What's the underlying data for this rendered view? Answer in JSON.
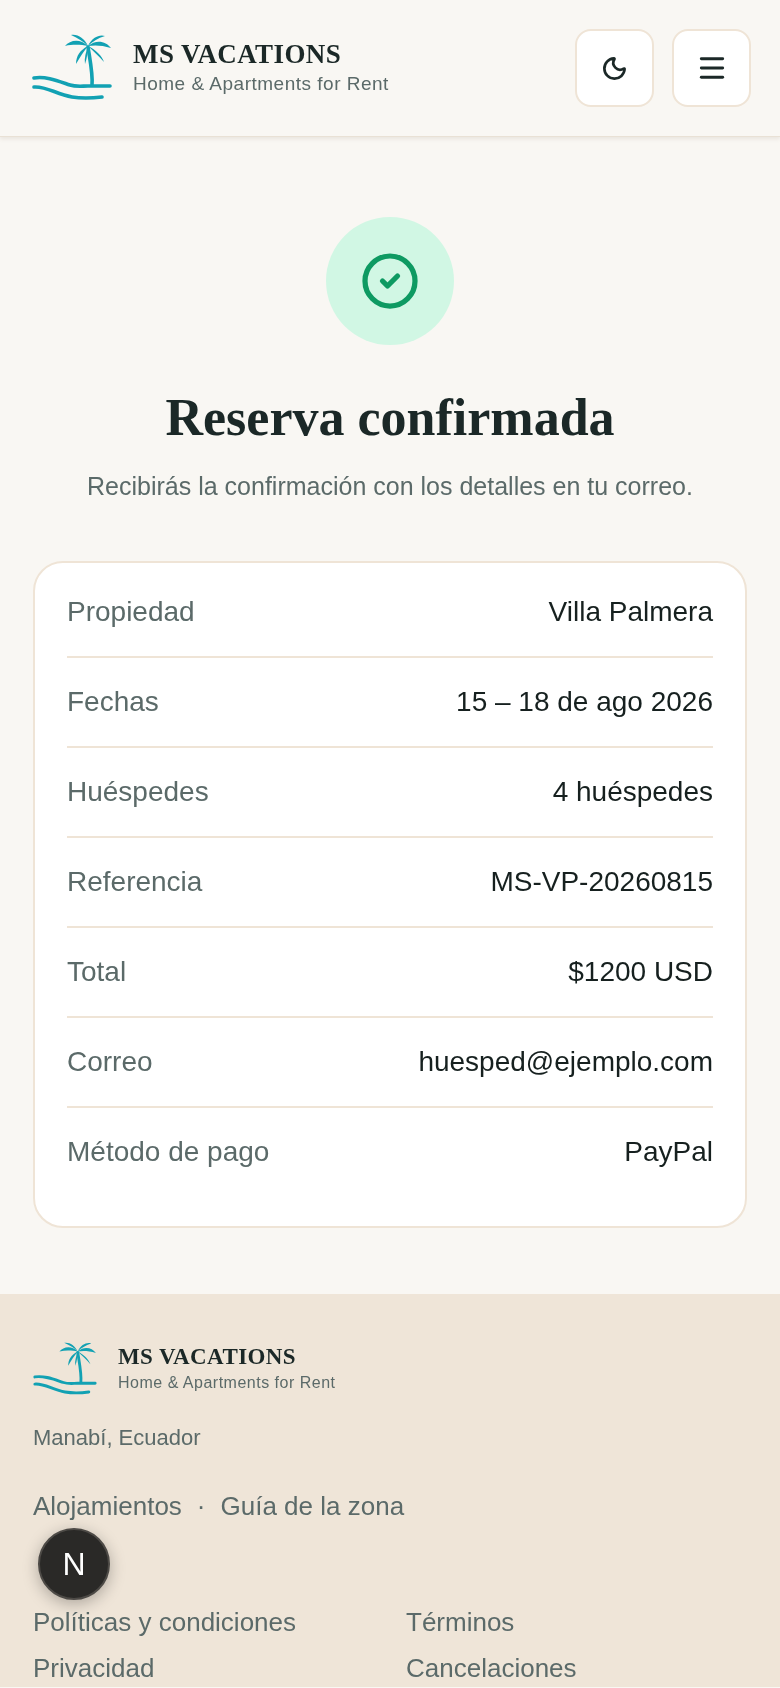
{
  "header": {
    "brand": {
      "name": "MS VACATIONS",
      "tagline": "Home & Apartments for Rent"
    }
  },
  "confirmation": {
    "title": "Reserva confirmada",
    "message": "Recibirás la confirmación con los detalles en tu correo."
  },
  "booking_details": [
    {
      "label": "Propiedad",
      "value": "Villa Palmera"
    },
    {
      "label": "Fechas",
      "value": "15 – 18 de ago 2026"
    },
    {
      "label": "Huéspedes",
      "value": "4 huéspedes"
    },
    {
      "label": "Referencia",
      "value": "MS-VP-20260815"
    },
    {
      "label": "Total",
      "value": "$1200 USD"
    },
    {
      "label": "Correo",
      "value": "huesped@ejemplo.com"
    },
    {
      "label": "Método de pago",
      "value": "PayPal"
    }
  ],
  "footer": {
    "brand": {
      "name": "MS VACATIONS",
      "tagline": "Home & Apartments for Rent"
    },
    "location": "Manabí, Ecuador",
    "nav_links": [
      "Alojamientos",
      "Guía de la zona"
    ],
    "nav_separator": "·",
    "policy_links": [
      "Políticas y condiciones",
      "Términos",
      "Privacidad",
      "Cancelaciones"
    ]
  },
  "floating_button": {
    "label": "N"
  }
}
